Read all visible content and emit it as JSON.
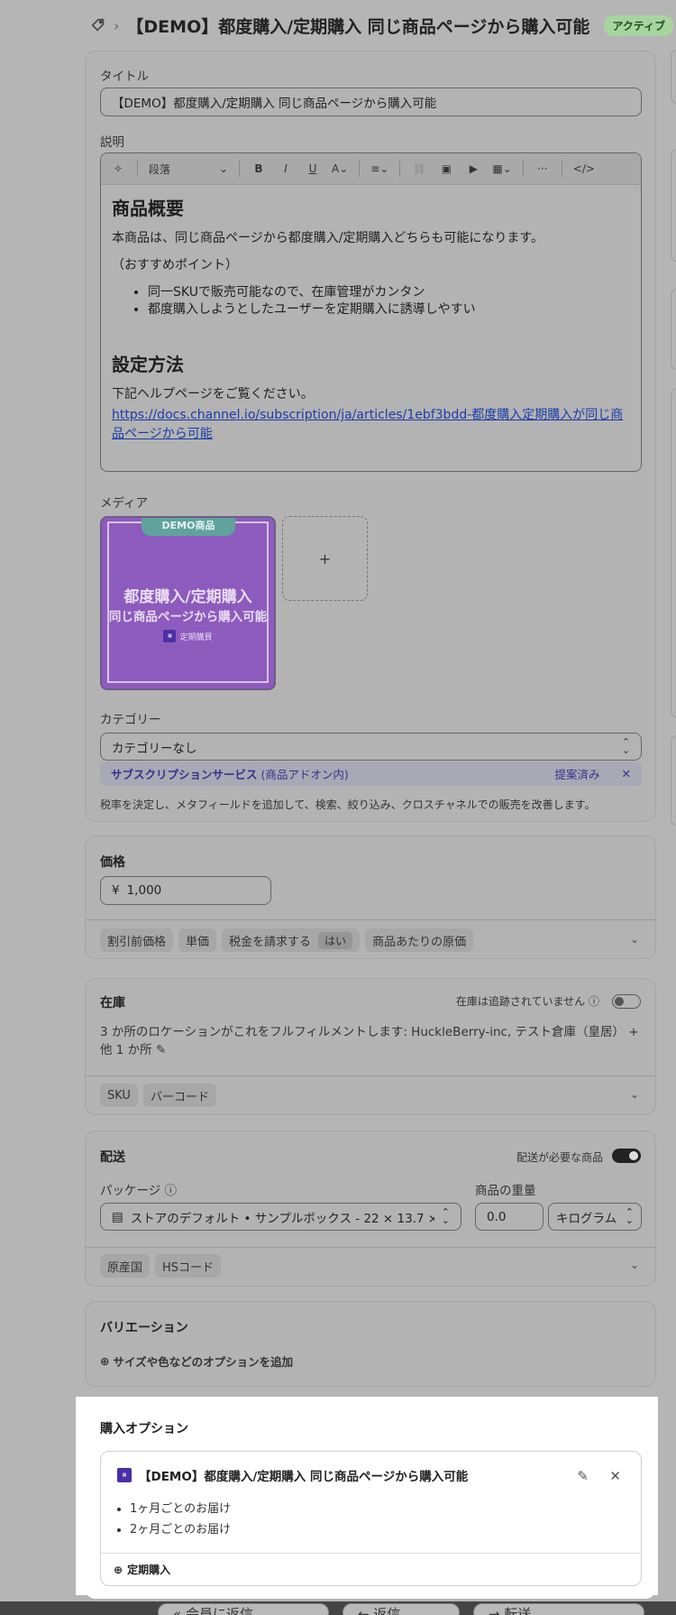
{
  "header": {
    "title": "【DEMO】都度購入/定期購入 同じ商品ページから購入可能",
    "status": "アクティブ"
  },
  "main": {
    "title_label": "タイトル",
    "title_value": "【DEMO】都度購入/定期購入 同じ商品ページから購入可能",
    "description_label": "説明",
    "editor": {
      "paragraph_style": "段落",
      "heading1": "商品概要",
      "para1": "本商品は、同じ商品ページから都度購入/定期購入どちらも可能になります。",
      "para2": "（おすすめポイント）",
      "bullets": [
        "同一SKUで販売可能なので、在庫管理がカンタン",
        "都度購入しようとしたユーザーを定期購入に誘導しやすい"
      ],
      "heading2": "設定方法",
      "para3": "下記ヘルプページをご覧ください。",
      "link": "https://docs.channel.io/subscription/ja/articles/1ebf3bdd-都度購入定期購入が同じ商品ページから可能"
    },
    "media_label": "メディア",
    "media_image": {
      "badge": "DEMO商品",
      "line1": "都度購入/定期購入",
      "line2": "同じ商品ページから購入可能",
      "logo_text": "定期購買"
    },
    "media_add": "+",
    "category_label": "カテゴリー",
    "category_value": "カテゴリーなし",
    "suggestion": {
      "name": "サブスクリプションサービス",
      "sub": "(商品アドオン内)",
      "status": "提案済み"
    },
    "category_help": "税率を決定し、メタフィールドを追加して、検索、絞り込み、クロスチャネルでの販売を改善します。"
  },
  "price": {
    "title": "価格",
    "currency": "¥",
    "value": "1,000",
    "chips": [
      "割引前価格",
      "単価",
      "税金を請求する",
      "商品あたりの原価"
    ],
    "tax_value": "はい"
  },
  "inventory": {
    "title": "在庫",
    "tracking_label": "在庫は追跡されていません",
    "locations": "3 か所のロケーションがこれをフルフィルメントします: HuckleBerry-inc, テスト倉庫（皇居） + 他 1 か所",
    "chips": [
      "SKU",
      "バーコード"
    ]
  },
  "shipping": {
    "title": "配送",
    "required_label": "配送が必要な商品",
    "package_label": "パッケージ",
    "package_value": "ストアのデフォルト • サンプルボックス - 22 × 13.7 ×",
    "weight_label": "商品の重量",
    "weight_value": "0.0",
    "weight_unit": "キログラム",
    "chips": [
      "原産国",
      "HSコード"
    ]
  },
  "variants": {
    "title": "バリエーション",
    "add_option": "サイズや色などのオプションを追加"
  },
  "purchase_options": {
    "title": "購入オプション",
    "app_title": "【DEMO】都度購入/定期購入 同じ商品ページから購入可能",
    "app_logo": "定期購買",
    "items": [
      "1ヶ月ごとのお届け",
      "2ヶ月ごとのお届け"
    ],
    "add_label": "定期購入"
  },
  "bottom_bar": [
    "会員に返信",
    "返信",
    "転送"
  ]
}
